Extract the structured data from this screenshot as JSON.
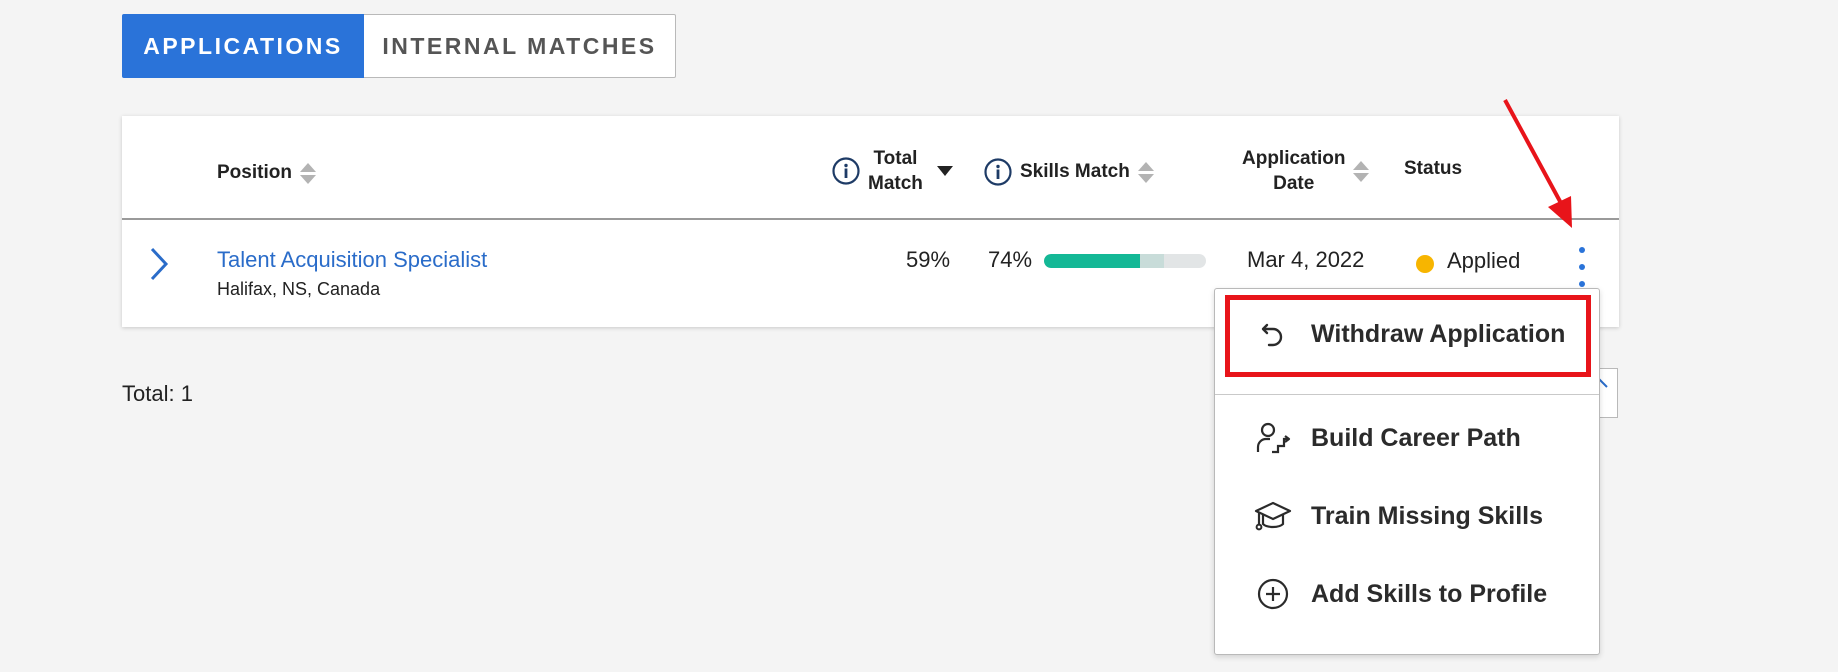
{
  "tabs": [
    {
      "label": "APPLICATIONS",
      "active": true
    },
    {
      "label": "INTERNAL MATCHES",
      "active": false
    }
  ],
  "table": {
    "headers": {
      "position": "Position",
      "total_match_line1": "Total",
      "total_match_line2": "Match",
      "skills_match": "Skills Match",
      "application_date_line1": "Application",
      "application_date_line2": "Date",
      "status": "Status"
    },
    "rows": [
      {
        "title": "Talent Acquisition Specialist",
        "location": "Halifax, NS, Canada",
        "total_match": "59%",
        "skills_match": "74%",
        "skills_match_fraction": 0.74,
        "date": "Mar 4, 2022",
        "status": "Applied"
      }
    ]
  },
  "footer": {
    "total": "Total: 1"
  },
  "menu": {
    "items": [
      {
        "label": "Withdraw Application",
        "icon": "undo-icon"
      },
      {
        "label": "Build Career Path",
        "icon": "career-path-icon"
      },
      {
        "label": "Train Missing Skills",
        "icon": "graduation-cap-icon"
      },
      {
        "label": "Add Skills to Profile",
        "icon": "plus-circle-icon"
      }
    ]
  },
  "colors": {
    "accent": "#2a73d9",
    "progress": "#14b896",
    "status_applied": "#f7b500",
    "annotation": "#e8141a"
  }
}
